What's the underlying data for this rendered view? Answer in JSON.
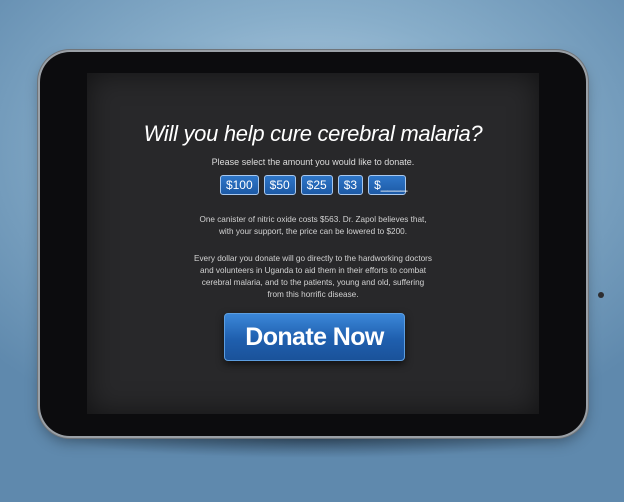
{
  "headline": "Will you help cure cerebral malaria?",
  "subtitle": "Please select the amount you would like to donate.",
  "amounts": [
    "$100",
    "$50",
    "$25",
    "$3",
    "$____"
  ],
  "paragraph1": "One canister of nitric oxide costs $563. Dr. Zapol believes that, with your support, the price can be lowered to $200.",
  "paragraph2": "Every dollar you donate will go directly to the hardworking doctors and volunteers in Uganda to aid them in their efforts to combat cerebral malaria, and to the patients, young and old, suffering from this horrific disease.",
  "donate_label": "Donate Now",
  "colors": {
    "accent": "#1f5fae",
    "screen_background": "#28282a",
    "page_background": "#88aeca"
  },
  "icons": {
    "home": "home-button-icon",
    "camera": "camera-icon"
  }
}
